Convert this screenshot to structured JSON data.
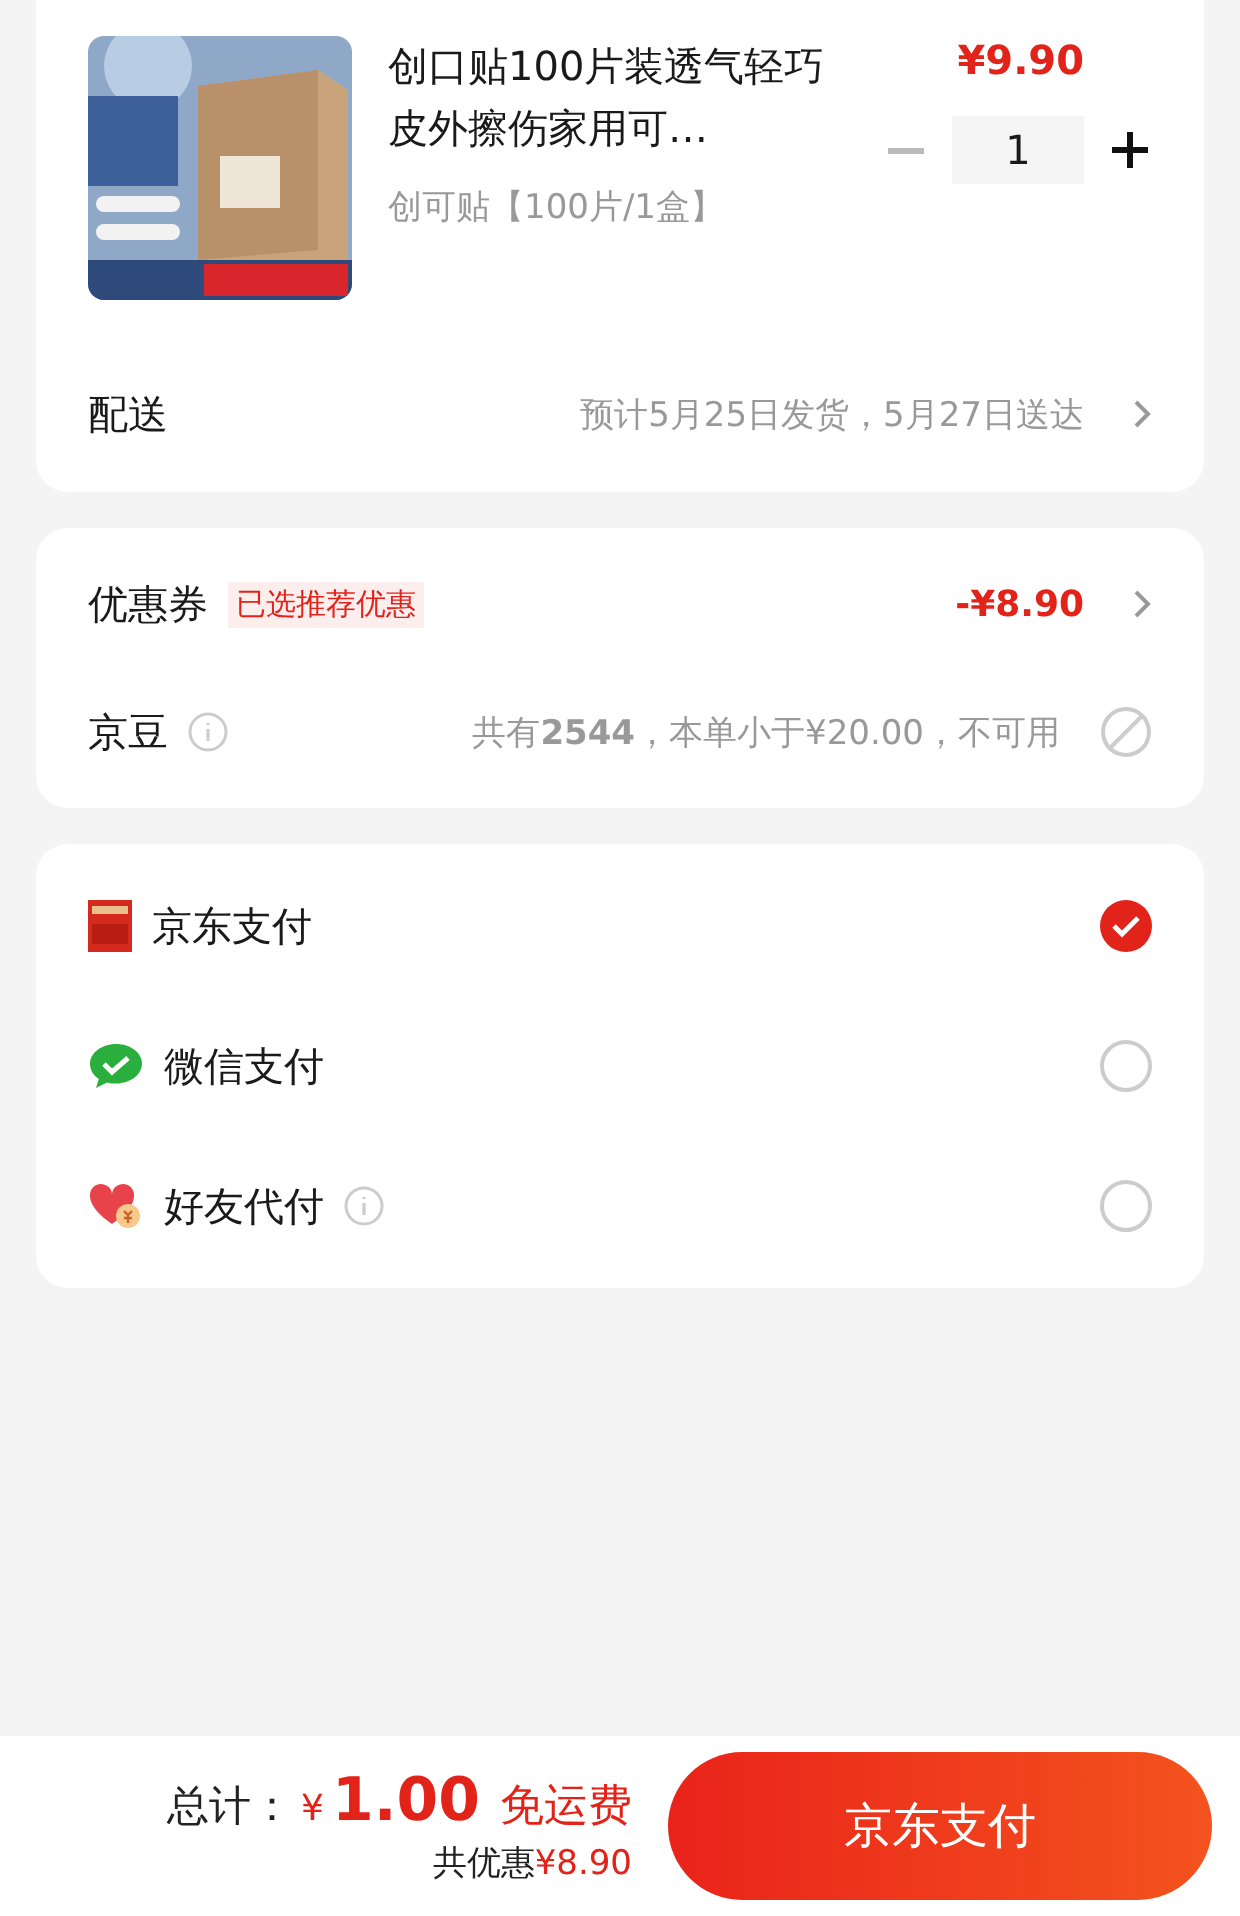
{
  "product": {
    "title": "创口贴100片装透气轻巧皮外擦伤家用可…",
    "variant": "创可贴【100片/1盒】",
    "price": "¥9.90",
    "quantity": "1"
  },
  "delivery": {
    "label": "配送",
    "value": "预计5月25日发货，5月27日送达"
  },
  "coupon": {
    "label": "优惠券",
    "tag": "已选推荐优惠",
    "value": "-¥8.90"
  },
  "beans": {
    "label": "京豆",
    "value": "共有**2544**，本单小于¥20.00，不可用",
    "usable": false
  },
  "payments": [
    {
      "kind": "jd",
      "label": "京东支付",
      "info": false,
      "selected": true
    },
    {
      "kind": "wechat",
      "label": "微信支付",
      "info": false,
      "selected": false
    },
    {
      "kind": "friend",
      "label": "好友代付",
      "info": true,
      "selected": false
    }
  ],
  "footer": {
    "total_label": "总计：",
    "currency": "¥",
    "amount": "1.00",
    "shipping": "免运费",
    "savings_label": "共优惠",
    "savings": "¥8.90",
    "pay_button": "京东支付"
  }
}
